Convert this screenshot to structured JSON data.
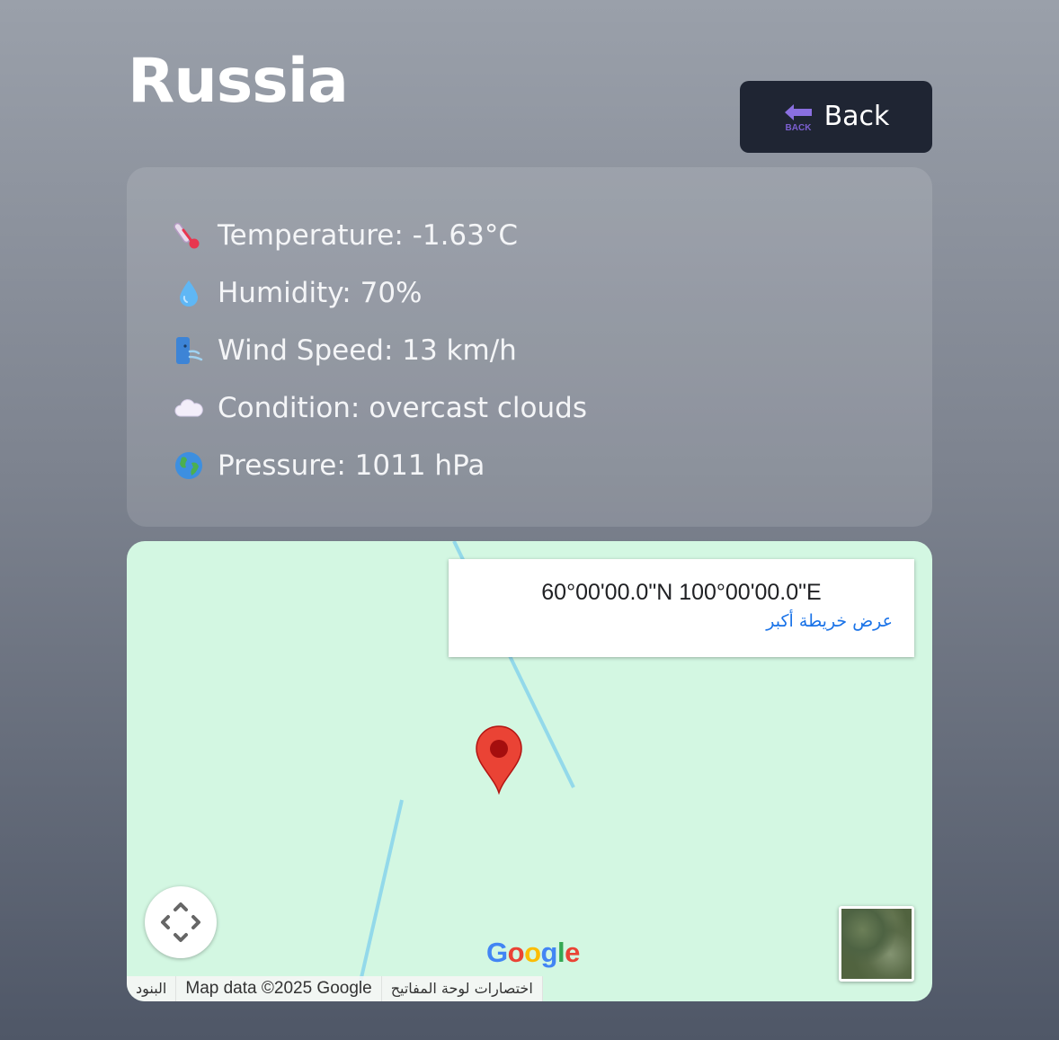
{
  "header": {
    "title": "Russia",
    "back_button": {
      "label": "Back",
      "icon": "back-arrow-icon",
      "icon_text": "BACK"
    }
  },
  "weather": {
    "items": [
      {
        "icon": "thermometer-icon",
        "text": "Temperature: -1.63°C"
      },
      {
        "icon": "droplet-icon",
        "text": "Humidity: 70%"
      },
      {
        "icon": "wind-face-icon",
        "text": "Wind Speed: 13 km/h"
      },
      {
        "icon": "cloud-icon",
        "text": "Condition: overcast clouds"
      },
      {
        "icon": "globe-icon",
        "text": "Pressure: 1011 hPa"
      }
    ]
  },
  "map": {
    "place_card": {
      "coordinates": "60°00'00.0\"N 100°00'00.0\"E",
      "larger_map_link": "عرض خريطة أكبر"
    },
    "logo_text": "Google",
    "attribution": {
      "terms": "البنود",
      "map_data": "Map data ©2025 Google",
      "keyboard_shortcuts": "اختصارات لوحة المفاتيح"
    },
    "colors": {
      "land": "#d3f7e2",
      "water": "#93d9ea",
      "pin": "#ea4335"
    }
  },
  "colors": {
    "button_bg": "#1f2533",
    "link": "#1a73e8",
    "back_icon": "#7c5fd1"
  }
}
